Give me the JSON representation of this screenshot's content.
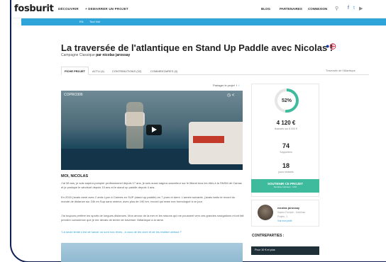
{
  "header": {
    "logo": "fosburit",
    "nav_left": [
      "DÉCOUVRIR",
      "+ DEMARRER UN PROJET"
    ],
    "nav_right": [
      "BLOG",
      "PARTENAIRES",
      "CONNEXION"
    ]
  },
  "subbar": {
    "items": [
      "EN",
      "Tout Voir"
    ]
  },
  "project": {
    "title": "La traversée de l'atlantique en Stand Up Paddle avec Nicolas !",
    "subtitle_prefix": "Campagne Classique",
    "subtitle_by": "par nicolas jarossay"
  },
  "tabs": [
    "FICHE PROJET",
    "ACTU (4)",
    "CONTRIBUTIONS (32)",
    "COMMENTAIRES (0)"
  ],
  "tab_right": "Traversée de l'Atlantique",
  "share_label": "Partager le projet",
  "video": {
    "label": "COPRO306"
  },
  "content": {
    "heading": "MOI, NICOLAS",
    "para1": "J'ai 38 ans, je suis sapeur-pompier professionnel depuis 17 ans, je suis aussi nageur-sauveteur sur le littoral tous les étés à la SNSM de Carnac et je pratique le windsurf depuis 15 ans et le stand up paddle depuis 4 ans.",
    "para2": "En 2015 j'avais ramé avec 2 amis Lyon à Cannes en SUP (stand up paddle) en 7 jours et demi. L'année suivante, j'avais battu le record du monde de distance sur 24h en Sup sans moteur, avec plus de 190 km, record qui reste non homologué à ce jour.",
    "para3": "J'ai toujours préféré les sports de longues distances. Mon amour de la mer et les raisons qui me poussent vers ces grandes navigations m'ont fait prendre conscience que je me devais de tenter de traverser l'Atlantique à la rame.",
    "para4": "\"Là seule limite c'est de savoir où sont nos rêves ; à vous de les vivre et de les réaliser debout !\""
  },
  "sidebar": {
    "percent": "52%",
    "percent_value": 52,
    "amount": "4 120 €",
    "amount_sub": "financés sur 8 000 €",
    "supporters": "74",
    "supporters_label": "Supporters",
    "days": "18",
    "days_label": "jours restants",
    "support_btn": "SOUTENIR CE PROJET",
    "support_btn_sub": "Nombre minimum : 10 €",
    "author_name": "nicolas jarossay",
    "author_meta1": "Sapeur-Pompier - Morbihan",
    "author_meta2": "Projets : 1",
    "author_link": "Voir mon profil",
    "counterparts_title": "CONTREPARTIES :",
    "counterpart_1": "Pour 10 € et plus"
  },
  "colors": {
    "accent": "#3dbb9c",
    "link": "#2a9fd6",
    "frame": "#0e1f55"
  }
}
